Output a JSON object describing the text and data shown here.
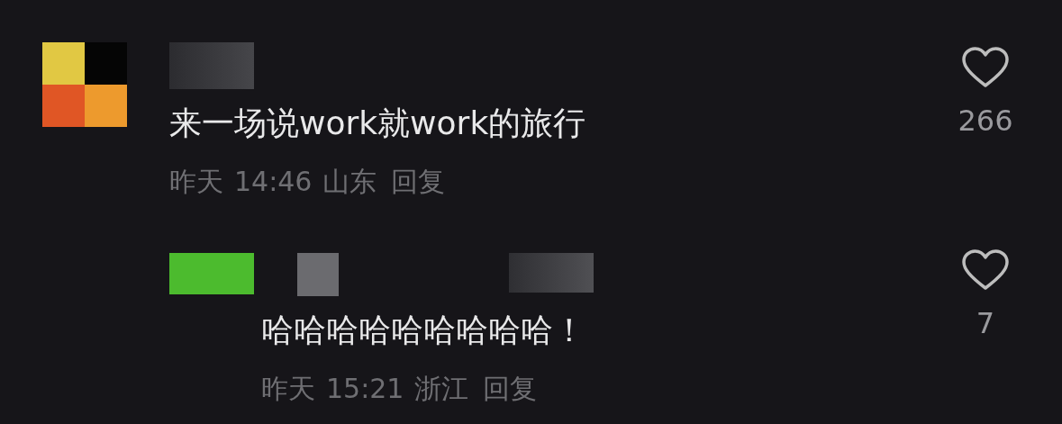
{
  "comments": [
    {
      "text": "来一场说work就work的旅行",
      "date": "昨天",
      "time": "14:46",
      "location": "山东",
      "reply_label": "回复",
      "likes": "266",
      "liked": false,
      "replies": [
        {
          "text": "哈哈哈哈哈哈哈哈哈！",
          "date": "昨天",
          "time": "15:21",
          "location": "浙江",
          "reply_label": "回复",
          "likes": "7",
          "liked": false
        }
      ]
    }
  ]
}
